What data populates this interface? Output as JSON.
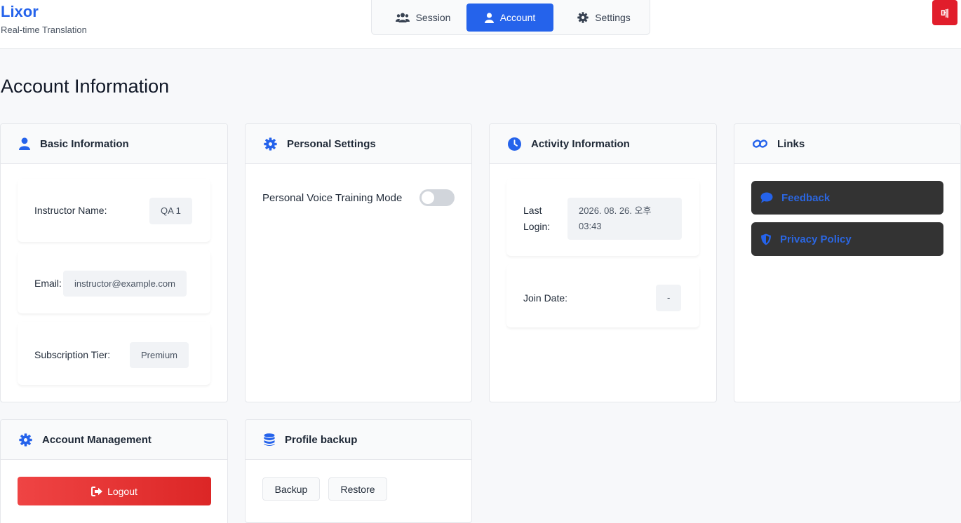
{
  "app": {
    "name": "Lixor",
    "subtitle": "Real-time Translation",
    "lang_button": "메"
  },
  "nav": {
    "tabs": [
      {
        "label": "Session"
      },
      {
        "label": "Account"
      },
      {
        "label": "Settings"
      }
    ],
    "active": "Account"
  },
  "page": {
    "title": "Account Information"
  },
  "basic_info": {
    "title": "Basic Information",
    "rows": [
      {
        "label": "Instructor Name:",
        "value": "QA 1"
      },
      {
        "label": "Email:",
        "value": "instructor@example.com"
      },
      {
        "label": "Subscription Tier:",
        "value": "Premium"
      }
    ]
  },
  "personal_settings": {
    "title": "Personal Settings",
    "voice_training_label": "Personal Voice Training Mode",
    "voice_training_enabled": false
  },
  "activity": {
    "title": "Activity Information",
    "last_login_label_1": "Last",
    "last_login_label_2": "Login:",
    "last_login_value_1": "2026. 08. 26. 오후",
    "last_login_value_2": "03:43",
    "join_label": "Join Date:",
    "join_value": "-"
  },
  "links": {
    "title": "Links",
    "feedback": "Feedback",
    "privacy": "Privacy Policy"
  },
  "account_mgmt": {
    "title": "Account Management",
    "logout": "Logout"
  },
  "backup": {
    "title": "Profile backup",
    "backup_btn": "Backup",
    "restore_btn": "Restore"
  },
  "colors": {
    "accent": "#2563eb",
    "danger": "#dc2626",
    "dark_button": "#333333"
  }
}
